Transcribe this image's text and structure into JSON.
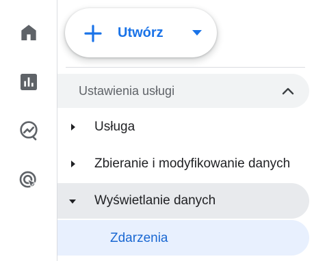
{
  "create_button": {
    "label": "Utwórz"
  },
  "sidebar": {
    "section_title": "Ustawienia usługi",
    "items": [
      {
        "label": "Usługa",
        "expanded": false
      },
      {
        "label": "Zbieranie i modyfikowanie danych",
        "expanded": false
      },
      {
        "label": "Wyświetlanie danych",
        "expanded": true
      }
    ],
    "sub_items": [
      {
        "label": "Zdarzenia",
        "selected": true
      }
    ]
  },
  "rail_icons": [
    "home-icon",
    "reports-icon",
    "explore-icon",
    "advertising-icon"
  ],
  "colors": {
    "accent": "#1a73e8",
    "selected_text": "#1967d2",
    "selected_bg": "#e8f0fe",
    "hover_bg": "#e8eaed",
    "header_bg": "#f1f3f4",
    "icon_gray": "#5f6368"
  }
}
